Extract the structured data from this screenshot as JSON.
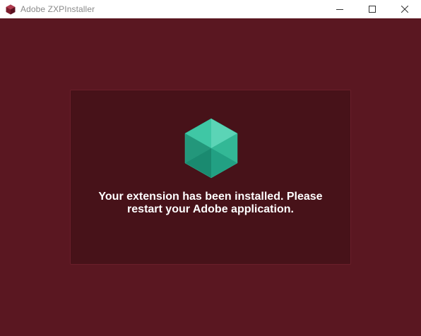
{
  "window": {
    "title": "Adobe ZXPInstaller",
    "controls": {
      "minimize_icon": "minimize-icon",
      "maximize_icon": "maximize-icon",
      "close_icon": "close-icon"
    }
  },
  "main": {
    "status_icon": "cube-icon",
    "message_line1": "Your extension has been installed. Please",
    "message_line2": "restart your Adobe application."
  },
  "colors": {
    "background": "#5a1721",
    "panel": "#471219",
    "accent_teal": "#2bb394",
    "text": "#ffffff"
  }
}
